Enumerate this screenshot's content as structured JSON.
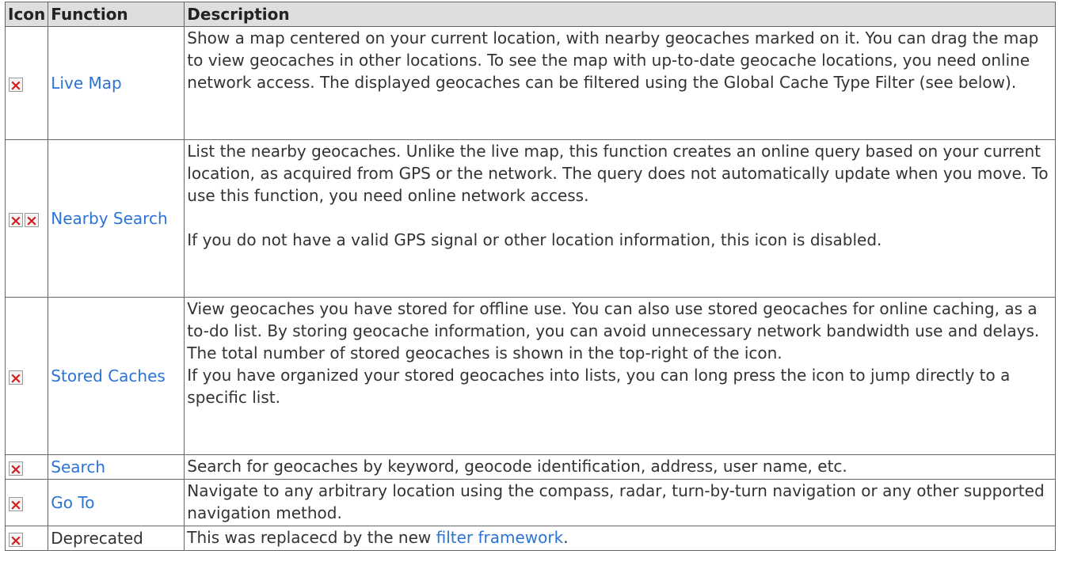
{
  "headers": {
    "icon": "Icon",
    "function": "Function",
    "description": "Description"
  },
  "rows": [
    {
      "function": "Live Map",
      "desc": [
        "Show a map centered on your current location, with nearby geocaches marked on it. You can drag the map to view geocaches in other locations. To see the map with up-to-date geocache locations, you need online network access. The displayed geocaches can be filtered using the Global Cache Type Filter (see below)."
      ]
    },
    {
      "function": "Nearby Search",
      "desc": [
        "List the nearby geocaches. Unlike the live map, this function creates an online query based on your current location, as acquired from GPS or the network. The query does not automatically update when you move. To use this function, you need online network access.",
        "If you do not have a valid GPS signal or other location information, this icon is disabled."
      ]
    },
    {
      "function": "Stored Caches",
      "desc": [
        "View geocaches you have stored for offline use. You can also use stored geocaches for online caching, as a to-do list. By storing geocache information, you can avoid unnecessary network bandwidth use and delays. The total number of stored geocaches is shown in the top-right of the icon.",
        "If you have organized your stored geocaches into lists, you can long press the icon to jump directly to a specific list."
      ]
    },
    {
      "function": "Search",
      "desc": [
        "Search for geocaches by keyword, geocode identification, address, user name, etc."
      ]
    },
    {
      "function": "Go To",
      "desc": [
        "Navigate to any arbitrary location using the compass, radar, turn-by-turn navigation or any other supported navigation method."
      ]
    },
    {
      "function": "Deprecated",
      "desc_prefix": "This was replacecd by the new ",
      "desc_link": "filter framework",
      "desc_suffix": "."
    }
  ],
  "colors": {
    "link": "#2b73d6",
    "header_bg": "#dedede",
    "border": "#666666",
    "icon_x": "#d21e1e"
  },
  "icons": [
    "broken-image-icon"
  ]
}
